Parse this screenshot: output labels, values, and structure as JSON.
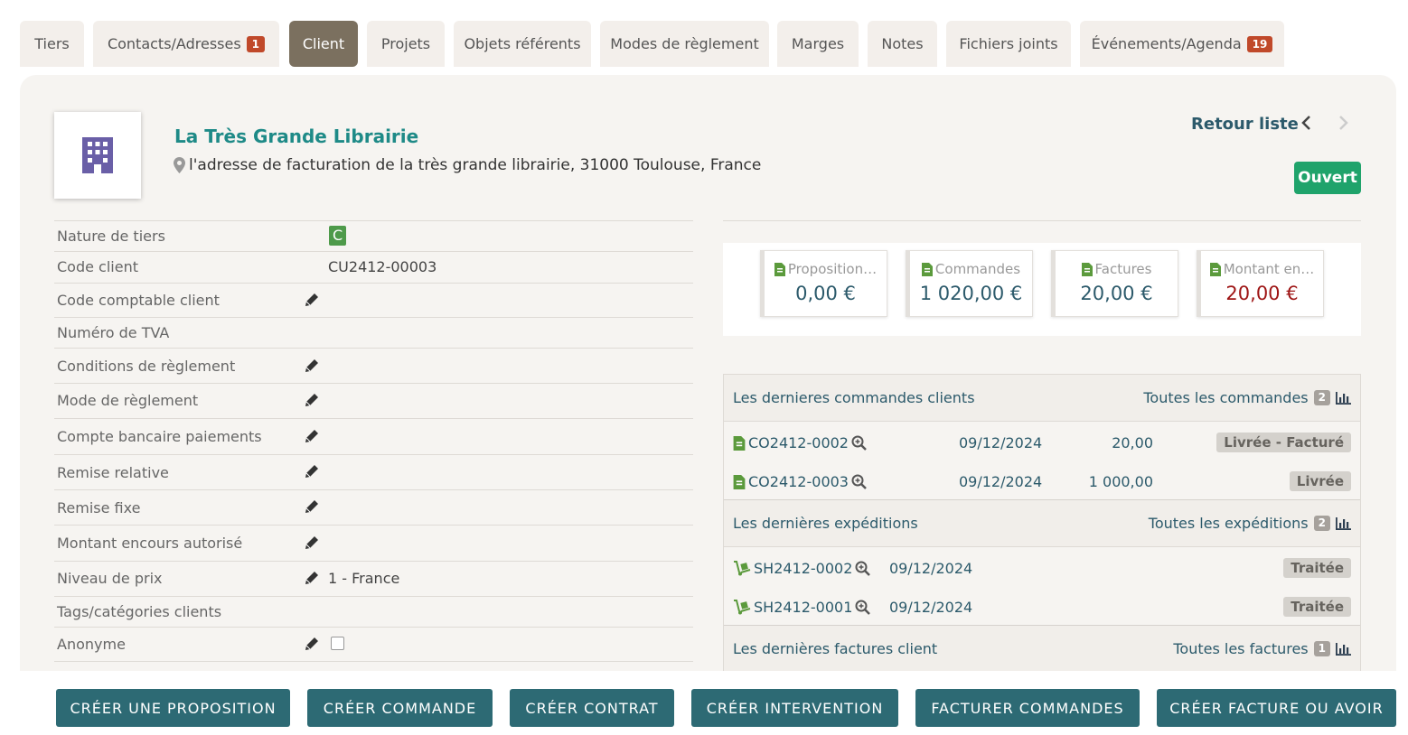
{
  "tabs": [
    {
      "label": "Tiers"
    },
    {
      "label": "Contacts/Adresses",
      "badge": "1"
    },
    {
      "label": "Client"
    },
    {
      "label": "Projets"
    },
    {
      "label": "Objets référents"
    },
    {
      "label": "Modes de règlement"
    },
    {
      "label": "Marges"
    },
    {
      "label": "Notes"
    },
    {
      "label": "Fichiers joints"
    },
    {
      "label": "Événements/Agenda",
      "badge": "19"
    }
  ],
  "company": {
    "name": "La Très Grande Librairie",
    "address": "l'adresse de facturation de la très grande librairie, 31000 Toulouse, France",
    "icon": "building-icon"
  },
  "nav": {
    "back_label": "Retour liste",
    "status": "Ouvert"
  },
  "fields": [
    {
      "label": "Nature de tiers",
      "badge": "C"
    },
    {
      "label": "Code client",
      "value": "CU2412-00003"
    },
    {
      "label": "Code comptable client",
      "edit": true
    },
    {
      "label": "Numéro de TVA"
    },
    {
      "label": "Conditions de règlement",
      "edit": true
    },
    {
      "label": "Mode de règlement",
      "edit": true
    },
    {
      "label": "Compte bancaire paiements",
      "edit": true
    },
    {
      "label": "Remise relative",
      "edit": true
    },
    {
      "label": "Remise fixe",
      "edit": true
    },
    {
      "label": "Montant encours autorisé",
      "edit": true
    },
    {
      "label": "Niveau de prix",
      "edit": true,
      "value": "1 - France"
    },
    {
      "label": "Tags/catégories clients"
    },
    {
      "label": "Anonyme",
      "edit": true,
      "checkbox": true
    }
  ],
  "stats": [
    {
      "label": "Proposition…",
      "value": "0,00 €"
    },
    {
      "label": "Commandes",
      "value": "1 020,00 €"
    },
    {
      "label": "Factures",
      "value": "20,00 €"
    },
    {
      "label": "Montant en…",
      "value": "20,00 €",
      "color": "#9e1515"
    }
  ],
  "orders": {
    "title": "Les dernieres commandes clients",
    "all_label": "Toutes les commandes",
    "count": "2",
    "rows": [
      {
        "ref": "CO2412-0002",
        "date": "09/12/2024",
        "amount": "20,00",
        "status": "Livrée - Facturé"
      },
      {
        "ref": "CO2412-0003",
        "date": "09/12/2024",
        "amount": "1 000,00",
        "status": "Livrée"
      }
    ]
  },
  "shipments": {
    "title": "Les dernières expéditions",
    "all_label": "Toutes les expéditions",
    "count": "2",
    "rows": [
      {
        "ref": "SH2412-0002",
        "date": "09/12/2024",
        "status": "Traitée"
      },
      {
        "ref": "SH2412-0001",
        "date": "09/12/2024",
        "status": "Traitée"
      }
    ]
  },
  "invoices": {
    "title": "Les dernières factures client",
    "all_label": "Toutes les factures",
    "count": "1"
  },
  "actions": [
    {
      "label": "CRÉER UNE PROPOSITION"
    },
    {
      "label": "CRÉER COMMANDE"
    },
    {
      "label": "CRÉER CONTRAT"
    },
    {
      "label": "CRÉER INTERVENTION"
    },
    {
      "label": "FACTURER COMMANDES"
    },
    {
      "label": "CRÉER FACTURE OU AVOIR"
    }
  ],
  "colors": {
    "accent": "#1e8a87",
    "tab_active": "#7b705f",
    "badge": "#c0492a",
    "button": "#2d6a74",
    "status_open": "#1fa36b",
    "link": "#2c5a6b"
  }
}
